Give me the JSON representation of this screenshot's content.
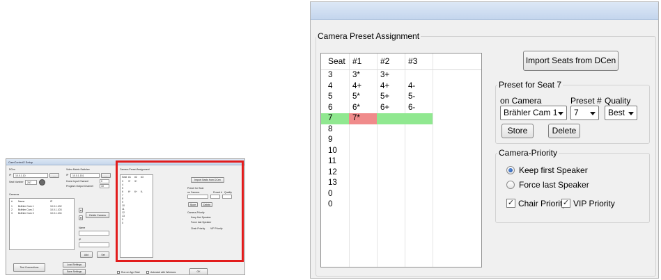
{
  "thumbnail": {
    "window_title": "CamControl2 Setup",
    "dcen_label": "DCen",
    "ip_label": "IP",
    "dcen_ip": "10.0.1.10",
    "seat_number_label": "Seat Number",
    "seat_number_value": "257",
    "video_switcher_label": "Video Matrix Switcher",
    "vms_ip": "10.0.1.151",
    "home_channel_label": "Home Input Channel",
    "home_channel_value": "0",
    "program_channel_label": "Program Output Channel",
    "program_channel_value": "10",
    "cameras_label": "Cameras",
    "cameras_columns": [
      "#",
      "Name",
      "IP"
    ],
    "cameras_rows": [
      [
        "1",
        "Brähler Cam 1",
        "10.0.1.102"
      ],
      [
        "2",
        "Brähler Cam 2",
        "10.0.1.103"
      ],
      [
        "3",
        "Brähler Cam 3",
        "10.0.1.104"
      ]
    ],
    "delete_camera": "Delete Camera",
    "name_label": "Name",
    "add_button": "Add",
    "set_button": "Set",
    "test_connections": "Test Connections",
    "load_settings": "Load Settings",
    "save_settings": "Save Settings",
    "run_on_app_start": "Run on App Start",
    "autostart_windows": "Autostart with Windows",
    "ok_button": "OK",
    "preset_group": "Camera Preset Assignment",
    "import_seats": "Import Seats from DCen",
    "preset_for_seat": "Preset for Seat",
    "on_camera": "on Camera",
    "preset_hash": "Preset #",
    "quality": "Quality",
    "store": "Store",
    "delete": "Delete",
    "camera_priority": "Camera-Priority",
    "keep_first": "Keep first Speaker",
    "force_last": "Force last Speaker",
    "chair_priority": "Chair Priority",
    "vip_priority": "VIP Priority",
    "table_header": [
      "Seat",
      "#1",
      "#2",
      "#3"
    ],
    "table_rows": [
      [
        "3",
        "3*",
        "3+",
        ""
      ],
      [
        "4",
        "",
        "",
        ""
      ],
      [
        "5",
        "",
        "",
        ""
      ],
      [
        "6",
        "6*",
        "6+",
        "6-"
      ],
      [
        "7",
        "",
        "",
        ""
      ],
      [
        "8",
        "",
        "",
        ""
      ],
      [
        "9",
        "",
        "",
        ""
      ],
      [
        "10",
        "",
        "",
        ""
      ],
      [
        "11",
        "",
        "",
        ""
      ],
      [
        "12",
        "",
        "",
        ""
      ],
      [
        "13",
        "",
        "",
        ""
      ],
      [
        "0",
        "",
        "",
        ""
      ],
      [
        "0",
        "",
        "",
        ""
      ]
    ]
  },
  "main": {
    "group_title": "Camera Preset Assignment",
    "table": {
      "columns": [
        "Seat",
        "#1",
        "#2",
        "#3"
      ],
      "rows": [
        [
          "3",
          "3*",
          "3+",
          ""
        ],
        [
          "4",
          "4+",
          "4+",
          "4-"
        ],
        [
          "5",
          "5*",
          "5+",
          "5-"
        ],
        [
          "6",
          "6*",
          "6+",
          "6-"
        ],
        [
          "7",
          "7*",
          "",
          ""
        ],
        [
          "8",
          "",
          "",
          ""
        ],
        [
          "9",
          "",
          "",
          ""
        ],
        [
          "10",
          "",
          "",
          ""
        ],
        [
          "11",
          "",
          "",
          ""
        ],
        [
          "12",
          "",
          "",
          ""
        ],
        [
          "13",
          "",
          "",
          ""
        ],
        [
          "0",
          "",
          "",
          ""
        ],
        [
          "0",
          "",
          "",
          ""
        ]
      ],
      "selected_row": 4,
      "selected_row_color": "#90e890",
      "selected_cell_color": "#f08b8b"
    },
    "import_button": "Import Seats from DCen",
    "preset_group_title": "Preset for Seat 7",
    "on_camera_label": "on Camera",
    "preset_label": "Preset #",
    "quality_label": "Quality",
    "camera_select": "Brähler Cam 1",
    "preset_select": "7",
    "quality_select": "Best",
    "store_button": "Store",
    "delete_button": "Delete",
    "priority_group_title": "Camera-Priority",
    "keep_first_label": "Keep first Speaker",
    "force_last_label": "Force last Speaker",
    "keep_first_selected": true,
    "chair_priority_label": "Chair Priority",
    "vip_priority_label": "VIP Priority",
    "chair_priority_checked": true,
    "vip_priority_checked": true,
    "highlight_color": "#e21c1c"
  }
}
